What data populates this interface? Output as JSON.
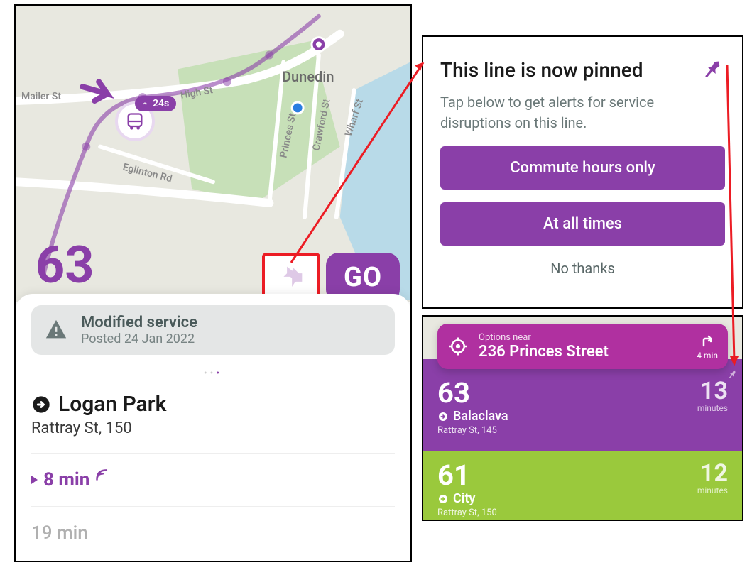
{
  "colors": {
    "brand": "#8a3fa8",
    "alert_highlight": "#ec1c24",
    "magenta": "#b030a0",
    "green": "#9ac93c"
  },
  "map": {
    "area_label": "Dunedin",
    "streets": [
      "Mailer St",
      "High St",
      "Eglinton Rd",
      "Princes St",
      "Crawford St",
      "Wharf St"
    ],
    "line_number": "63",
    "bus_badge": "24s",
    "go_label": "GO"
  },
  "alert": {
    "title": "Modified service",
    "posted": "Posted 24 Jan 2022"
  },
  "destination": {
    "name": "Logan Park",
    "stop": "Rattray St, 150"
  },
  "arrivals": {
    "next": "8 min",
    "after": "19 min"
  },
  "pinned_dialog": {
    "title": "This line is now pinned",
    "subtitle": "Tap below to get alerts for service disruptions on this line.",
    "option_commute": "Commute hours only",
    "option_all": "At all times",
    "dismiss": "No thanks"
  },
  "nearby": {
    "search_label": "Options near",
    "search_value": "236 Princes Street",
    "walk_time": "4 min",
    "lines": [
      {
        "num": "63",
        "dest": "Balaclava",
        "stop": "Rattray St, 145",
        "mins": "13",
        "unit": "minutes"
      },
      {
        "num": "61",
        "dest": "City",
        "stop": "Rattray St, 150",
        "mins": "12",
        "unit": "minutes"
      }
    ]
  }
}
